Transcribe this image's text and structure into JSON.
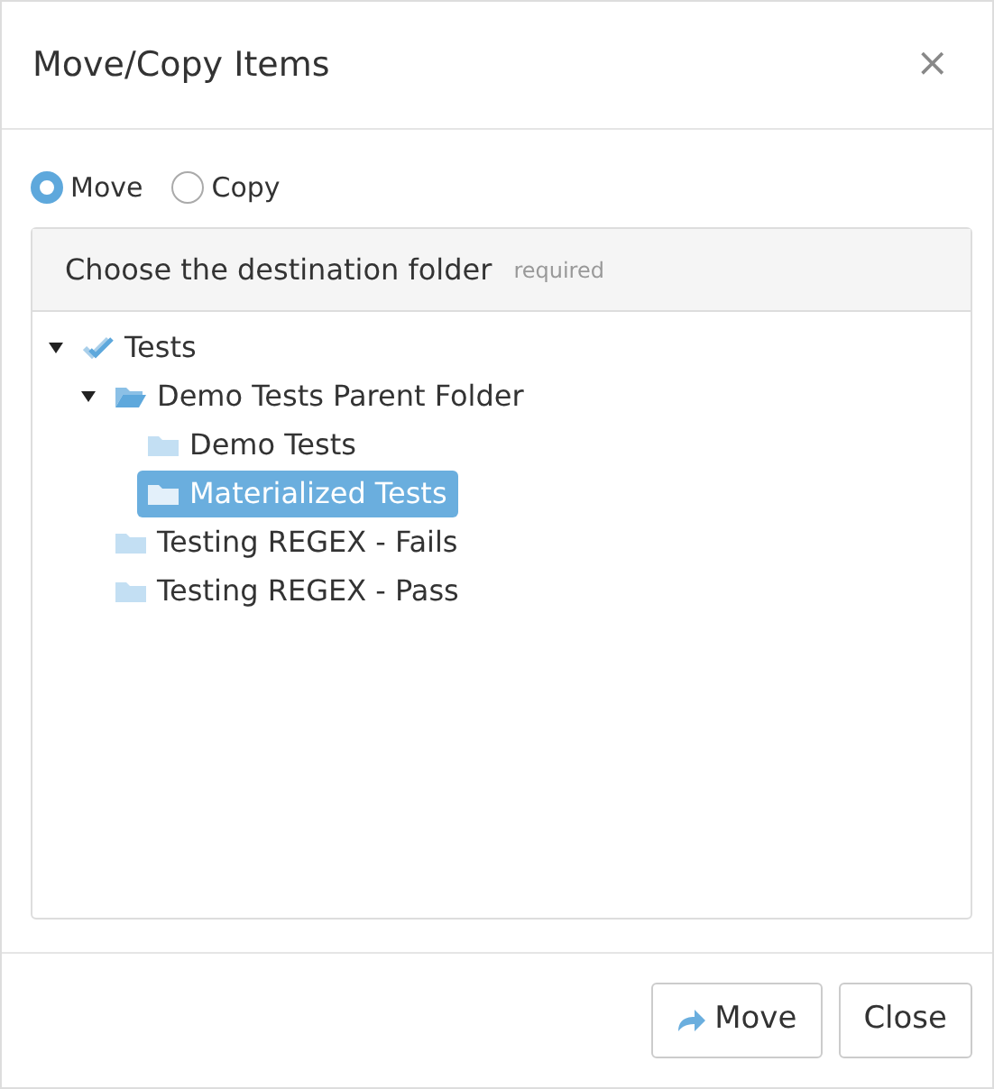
{
  "dialog": {
    "title": "Move/Copy Items",
    "close": "×"
  },
  "modes": [
    {
      "label": "Move",
      "selected": true
    },
    {
      "label": "Copy",
      "selected": false
    }
  ],
  "panel": {
    "heading": "Choose the destination folder",
    "hint": "required"
  },
  "tree": [
    {
      "label": "Tests",
      "kind": "root",
      "expanded": true,
      "selected": false,
      "children": [
        {
          "label": "Demo Tests Parent Folder",
          "kind": "folder",
          "expanded": true,
          "selected": false,
          "children": [
            {
              "label": "Demo Tests",
              "kind": "folder",
              "selected": false
            },
            {
              "label": "Materialized Tests",
              "kind": "folder",
              "selected": true
            }
          ]
        },
        {
          "label": "Testing REGEX - Fails",
          "kind": "folder",
          "selected": false
        },
        {
          "label": "Testing REGEX - Pass",
          "kind": "folder",
          "selected": false
        }
      ]
    }
  ],
  "buttons": [
    {
      "label": "Move",
      "kind": "primary"
    },
    {
      "label": "Close",
      "kind": "plain"
    }
  ]
}
